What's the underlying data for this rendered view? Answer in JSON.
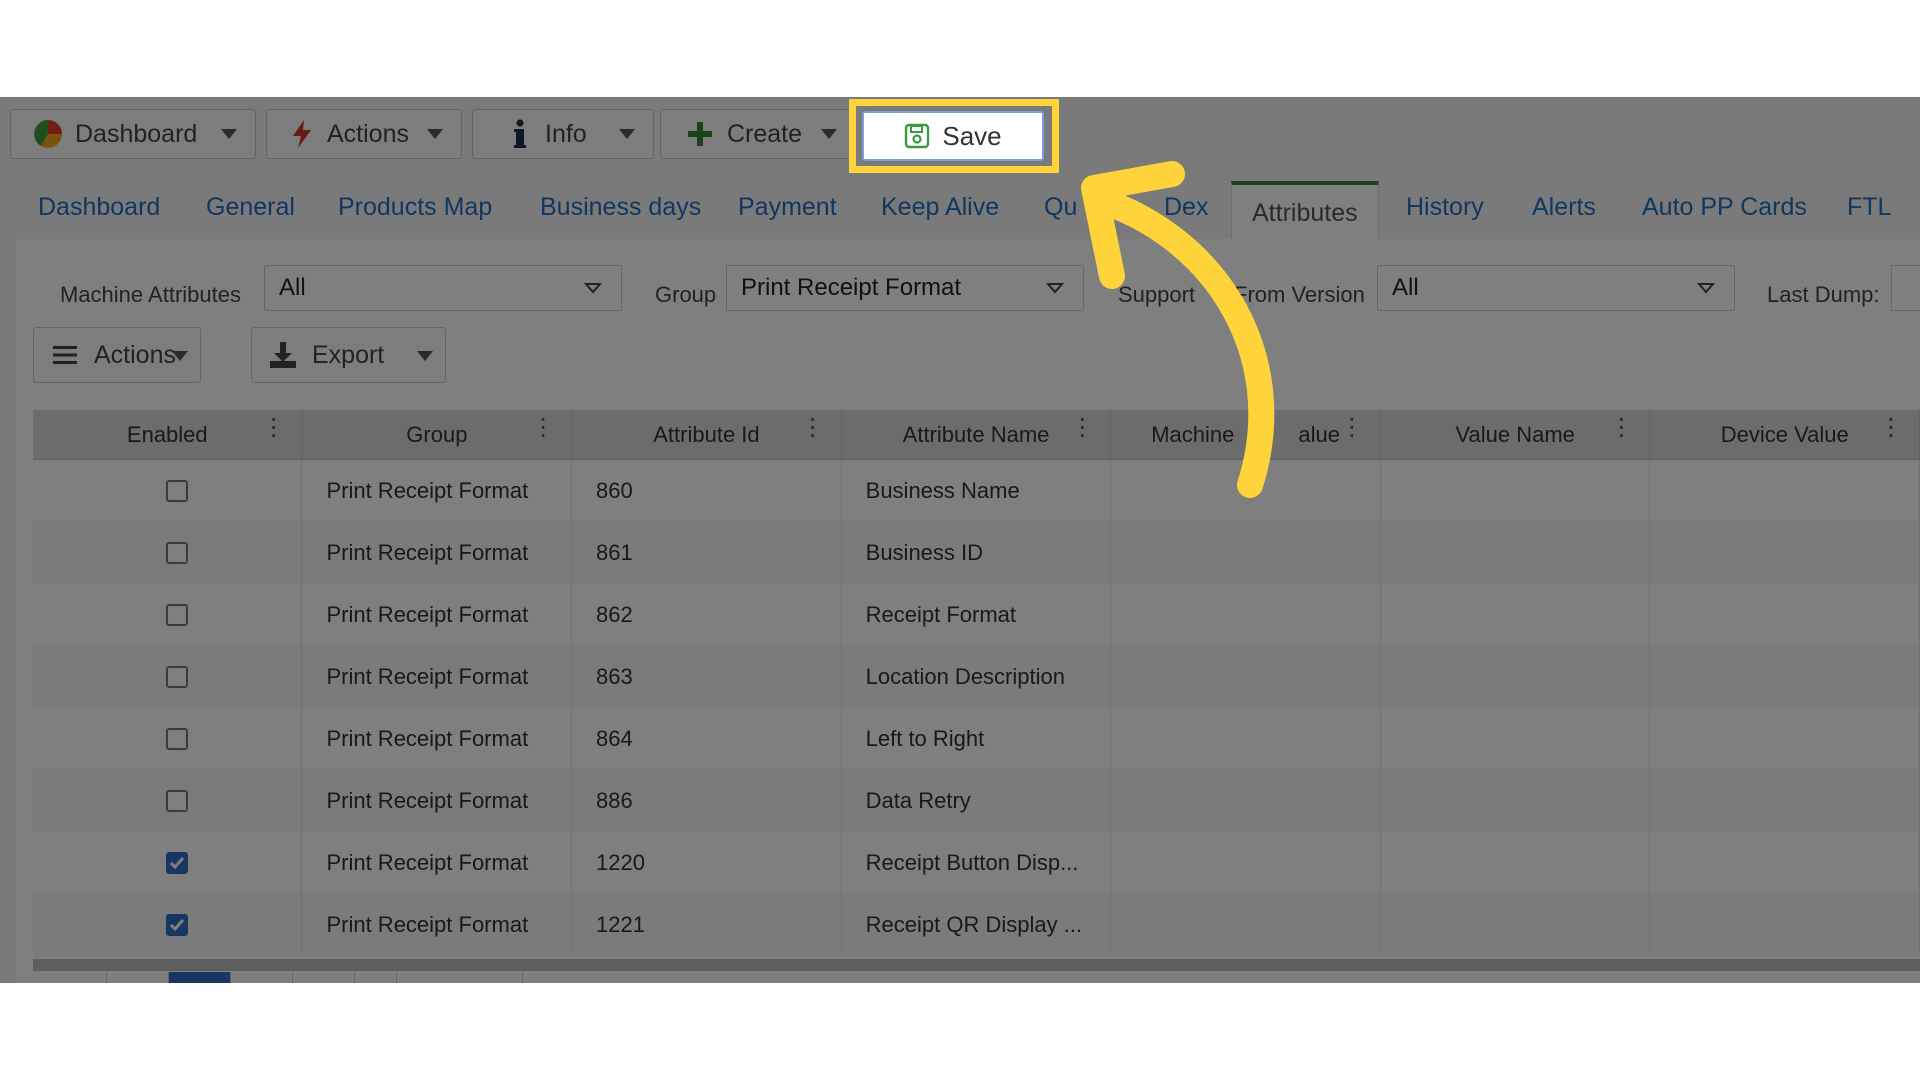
{
  "toolbar": {
    "dashboard_label": "Dashboard",
    "actions_label": "Actions",
    "info_label": "Info",
    "create_label": "Create",
    "save_label": "Save"
  },
  "tabs": [
    {
      "label": "Dashboard"
    },
    {
      "label": "General"
    },
    {
      "label": "Products Map"
    },
    {
      "label": "Business days"
    },
    {
      "label": "Payment"
    },
    {
      "label": "Keep Alive"
    },
    {
      "label": "Qu"
    },
    {
      "label": "Dex"
    },
    {
      "label": "Attributes",
      "active": true
    },
    {
      "label": "History"
    },
    {
      "label": "Alerts"
    },
    {
      "label": "Auto PP Cards"
    },
    {
      "label": "FTL"
    }
  ],
  "filters": {
    "machine_attributes_label": "Machine Attributes",
    "machine_attributes_value": "All",
    "group_label": "Group",
    "group_value": "Print Receipt Format",
    "supported_label_a": "Support",
    "supported_label_b": "From Version",
    "supported_value": "All",
    "last_dump_label": "Last Dump:"
  },
  "grid_toolbar": {
    "actions_label": "Actions",
    "export_label": "Export"
  },
  "grid": {
    "columns": [
      "Enabled",
      "Group",
      "Attribute Id",
      "Attribute Name",
      "Machine",
      "alue",
      "Value Name",
      "Device Value"
    ],
    "rows": [
      {
        "enabled": false,
        "group": "Print Receipt Format",
        "id": "860",
        "name": "Business Name"
      },
      {
        "enabled": false,
        "group": "Print Receipt Format",
        "id": "861",
        "name": "Business ID"
      },
      {
        "enabled": false,
        "group": "Print Receipt Format",
        "id": "862",
        "name": "Receipt Format"
      },
      {
        "enabled": false,
        "group": "Print Receipt Format",
        "id": "863",
        "name": "Location Description"
      },
      {
        "enabled": false,
        "group": "Print Receipt Format",
        "id": "864",
        "name": "Left to Right"
      },
      {
        "enabled": false,
        "group": "Print Receipt Format",
        "id": "886",
        "name": "Data Retry"
      },
      {
        "enabled": true,
        "group": "Print Receipt Format",
        "id": "1220",
        "name": "Receipt Button Disp..."
      },
      {
        "enabled": true,
        "group": "Print Receipt Format",
        "id": "1221",
        "name": "Receipt QR Display ..."
      }
    ]
  },
  "colors": {
    "highlight": "#ffd43b",
    "tab_link": "#1f6fbf",
    "active_tab_border": "#2e8b2e",
    "checkbox_checked": "#2f6fc6"
  }
}
